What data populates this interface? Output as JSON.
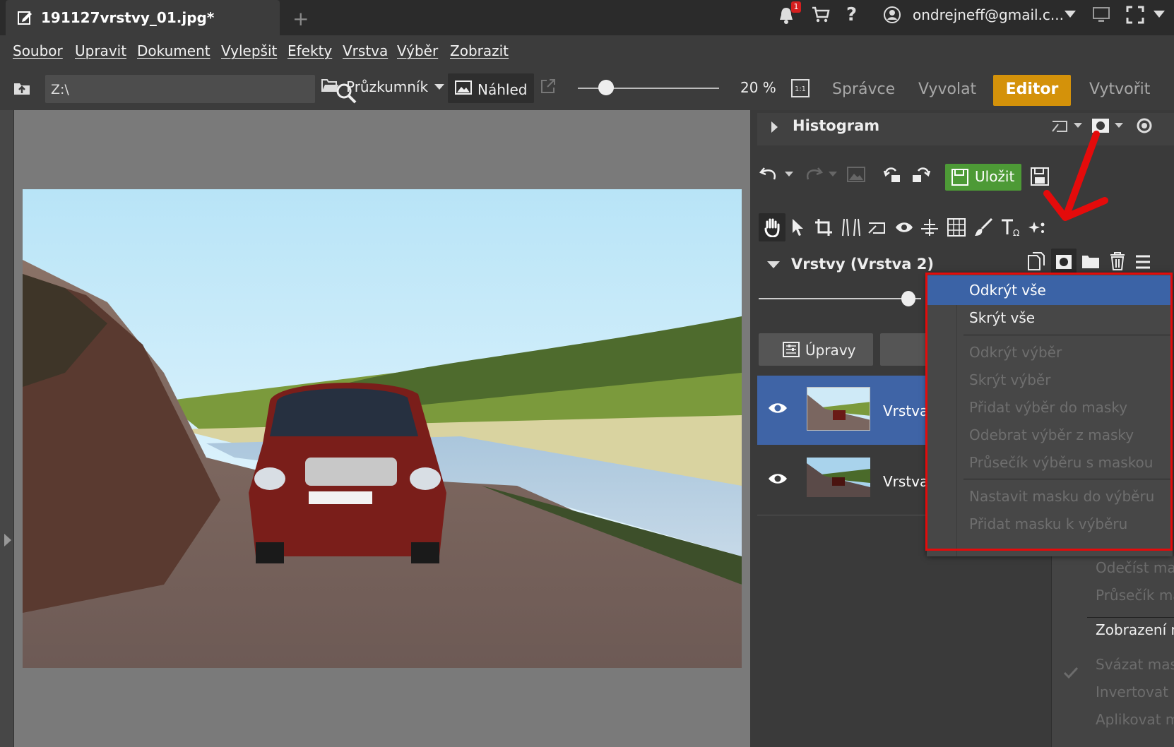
{
  "tab": {
    "title": "191127vrstvy_01.jpg*",
    "new_tab": "+"
  },
  "header": {
    "notification_count": "1",
    "help": "?",
    "user_email": "ondrejneff@gmail.c..."
  },
  "menu": [
    "Soubor",
    "Upravit",
    "Dokument",
    "Vylepšit",
    "Efekty",
    "Vrstva",
    "Výběr",
    "Zobrazit"
  ],
  "toolbar": {
    "path": "Z:\\",
    "explorer_label": "Průzkumník",
    "preview_label": "Náhled",
    "zoom": "20 %",
    "zoom_slider_fraction": 0.2,
    "modes": [
      "Správce",
      "Vyvolat",
      "Editor",
      "Vytvořit"
    ],
    "active_mode": "Editor"
  },
  "panel": {
    "histogram_title": "Histogram",
    "save_label": "Uložit",
    "layers_title": "Vrstvy (Vrstva 2)",
    "adjust_label": "Úpravy",
    "opacity_fraction": 0.92,
    "layers": [
      {
        "name": "Vrstva",
        "selected": true
      },
      {
        "name": "Vrstva",
        "selected": false
      }
    ]
  },
  "context_menu": {
    "items": [
      "Odkrýt vše",
      "Skrýt vše",
      "Odkrýt výběr",
      "Skrýt výběr",
      "Přidat výběr do masky",
      "Odebrat výběr z masky",
      "Průsečík výběru s maskou",
      "Nastavit masku do výběru",
      "Přidat masku k výběru"
    ],
    "highlighted": "Odkrýt vše",
    "enabled": [
      "Odkrýt vše",
      "Skrýt vše"
    ]
  },
  "submenu": {
    "items": [
      "Odečíst mas",
      "Průsečík ma",
      "Zobrazení m",
      "Svázat mask",
      "Invertovat m",
      "Aplikovat m"
    ]
  },
  "colors": {
    "accent": "#d4920a",
    "selection": "#3f64a6",
    "save_green": "#4d9a36",
    "annotation_red": "#e40b0b"
  }
}
